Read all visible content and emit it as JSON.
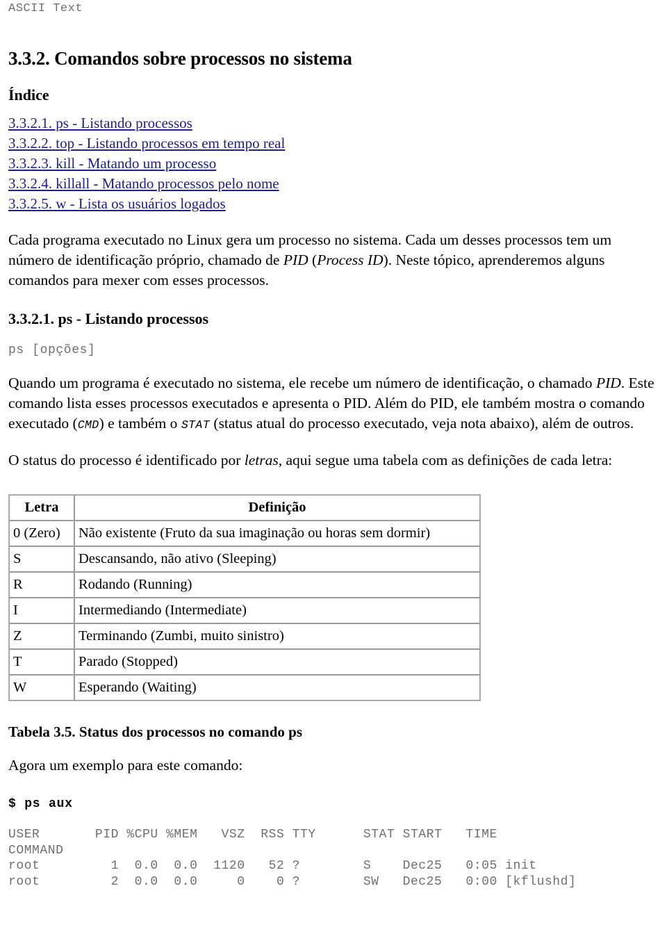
{
  "header": {
    "running_head": "ASCII Text"
  },
  "section": {
    "title": "3.3.2. Comandos sobre processos no sistema",
    "index_heading": "Índice"
  },
  "toc": {
    "items": [
      {
        "label": "3.3.2.1. ps - Listando processos"
      },
      {
        "label": "3.3.2.2. top - Listando processos em tempo real"
      },
      {
        "label": "3.3.2.3. kill - Matando um processo"
      },
      {
        "label": "3.3.2.4. killall - Matando processos pelo nome"
      },
      {
        "label": "3.3.2.5. w - Lista os usuários logados"
      }
    ]
  },
  "intro": {
    "part1": "Cada programa executado no Linux gera um processo no sistema. Cada um desses processos tem um número de identificação próprio, chamado de ",
    "em1": "PID",
    "part2": " (",
    "em2": "Process ID",
    "part3": "). Neste tópico, aprenderemos alguns comandos para mexer com esses processos."
  },
  "subsection": {
    "title": "3.3.2.1. ps - Listando processos",
    "synopsis": "ps [opções]",
    "para": {
      "part1": "Quando um programa é executado no sistema, ele recebe um número de identificação, o chamado ",
      "em1": "PID",
      "part2": ". Este comando lista esses processos executados e apresenta o PID. Além do PID, ele também mostra o comando executado (",
      "code1": "CMD",
      "part3": ") e também o ",
      "code2": "STAT",
      "part4": " (status atual do processo executado, veja nota abaixo), além de outros."
    }
  },
  "status_intro": {
    "part1": "O status do processo é identificado por ",
    "em1": "letras",
    "part2": ", aqui segue uma tabela com as definições de cada letra:"
  },
  "status_table": {
    "columns": [
      "Letra",
      "Definição"
    ],
    "rows": [
      {
        "letra": "0 (Zero)",
        "definicao": "Não existente (Fruto da sua imaginação ou horas sem dormir)"
      },
      {
        "letra": "S",
        "definicao": "Descansando, não ativo (Sleeping)"
      },
      {
        "letra": "R",
        "definicao": "Rodando (Running)"
      },
      {
        "letra": "I",
        "definicao": "Intermediando (Intermediate)"
      },
      {
        "letra": "Z",
        "definicao": "Terminando (Zumbi, muito sinistro)"
      },
      {
        "letra": "T",
        "definicao": "Parado (Stopped)"
      },
      {
        "letra": "W",
        "definicao": "Esperando (Waiting)"
      }
    ],
    "caption": "Tabela 3.5. Status dos processos no comando ps"
  },
  "example": {
    "lead": "Agora um exemplo para este comando:",
    "command": "$ ps aux",
    "output": "USER       PID %CPU %MEM   VSZ  RSS TTY      STAT START   TIME\nCOMMAND\nroot         1  0.0  0.0  1120   52 ?        S    Dec25   0:05 init\nroot         2  0.0  0.0     0    0 ?        SW   Dec25   0:00 [kflushd]"
  },
  "colors": {
    "link": "#20208c",
    "code_gray": "#6f6f6f",
    "table_border": "#9a9a9a",
    "text": "#000000"
  }
}
